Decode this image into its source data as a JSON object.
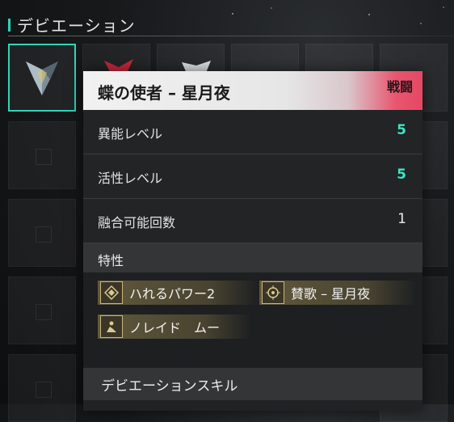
{
  "section": {
    "title": "デビエーション"
  },
  "card": {
    "name": "蝶の使者 – 星月夜",
    "tag": "戦闘",
    "stats": [
      {
        "label": "異能レベル",
        "value": "5",
        "accent": true
      },
      {
        "label": "活性レベル",
        "value": "5",
        "accent": true
      },
      {
        "label": "融合可能回数",
        "value": "1",
        "accent": false
      }
    ],
    "traits_label": "特性",
    "traits": [
      {
        "icon": "diamond-icon",
        "label": "ハれるパワー2"
      },
      {
        "icon": "crosshair-icon",
        "label": "賛歌 – 星月夜"
      },
      {
        "icon": "figure-icon",
        "label": "ノレイド　ムー"
      }
    ],
    "skills_label": "デビエーションスキル"
  },
  "colors": {
    "accent": "#3ee3c4",
    "tag": "#e54862",
    "chip": "#786c46"
  }
}
